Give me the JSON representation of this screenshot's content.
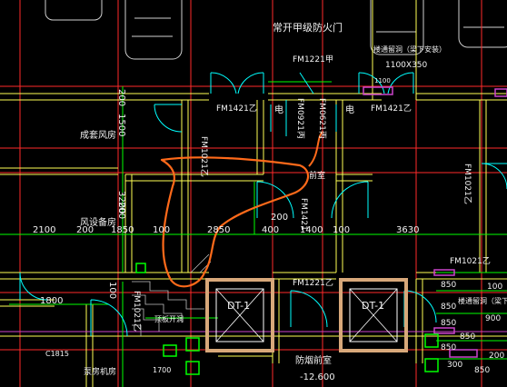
{
  "drawing": {
    "background": "#000000",
    "colors": {
      "axis": "#ff2a2a",
      "wall": "#ffff55",
      "door": "#00ffff",
      "dim": "#00ff00",
      "elevator": "#d8a87a",
      "sketch": "#ff6a1a",
      "shaft": "#cc44cc",
      "text": "#f2f2f2"
    }
  },
  "labels": {
    "top_note": "常开甲级防火门",
    "fm1221_top": "FM1221甲",
    "vent_note": "楼通留洞（梁下安装）",
    "vent_size": "1100X350",
    "vent_small": "1100",
    "fm1421_a": "FM1421乙",
    "fm1421_b": "FM1421乙",
    "fm1021_left": "FM1021乙",
    "fm0921": "FM0921丙",
    "fm0621": "FM0621丙",
    "elec": "电",
    "elec2": "电",
    "fm1021_right": "FM1021乙",
    "fm1021_right2": "FM1021乙",
    "room_left": "成套风房",
    "room_mid": "前室",
    "fm1421_mid": "FM1421",
    "room_left2": "风设备房",
    "fm1221_bottom": "FM1221乙",
    "dt1_a": "DT-1",
    "dt1_b": "DT-1",
    "floor_opening": "顶板开洞",
    "fire_room": "防烟前室",
    "elev": "-12.600",
    "vent_note2": "楼通留洞（梁下",
    "c1815": "C1815",
    "equip_room": "泵房机房",
    "bottom_dim": "1700"
  },
  "dimensions": {
    "d2100": "2100",
    "d200": "200",
    "d1850": "1850",
    "d100": "100",
    "d2850": "2850",
    "d400": "400",
    "d1400": "1400",
    "d100b": "100",
    "d3630": "3630",
    "v200": "200",
    "v1500": "1500",
    "v200b": "200",
    "v3200": "3200",
    "d1800": "1800",
    "d200mid": "200",
    "v100": "100",
    "d850a": "850",
    "d850b": "850",
    "d850c": "850",
    "d900": "900",
    "d850d": "850",
    "d850e": "850",
    "d850f": "850",
    "d300": "300",
    "d100c": "100",
    "d200c": "200"
  }
}
